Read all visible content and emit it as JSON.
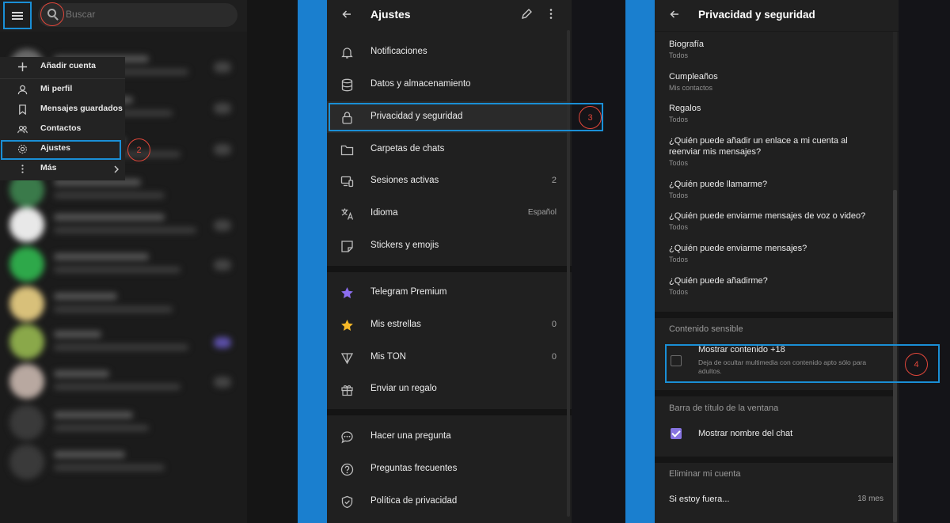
{
  "panel1": {
    "search": {
      "placeholder": "Buscar"
    },
    "menu": {
      "items": [
        {
          "label": "Añadir cuenta",
          "icon": "plus-icon"
        },
        {
          "label": "Mi perfil",
          "icon": "user-icon"
        },
        {
          "label": "Mensajes guardados",
          "icon": "bookmark-icon"
        },
        {
          "label": "Contactos",
          "icon": "contacts-icon"
        },
        {
          "label": "Ajustes",
          "icon": "gear-icon"
        },
        {
          "label": "Más",
          "icon": "more-vertical-icon"
        }
      ]
    },
    "step_badge": "2"
  },
  "panel2": {
    "title": "Ajustes",
    "items": [
      {
        "label": "Notificaciones",
        "icon": "bell-icon",
        "value": ""
      },
      {
        "label": "Datos y almacenamiento",
        "icon": "database-icon",
        "value": ""
      },
      {
        "label": "Privacidad y seguridad",
        "icon": "lock-icon",
        "value": ""
      },
      {
        "label": "Carpetas de chats",
        "icon": "folder-icon",
        "value": ""
      },
      {
        "label": "Sesiones activas",
        "icon": "devices-icon",
        "value": "2"
      },
      {
        "label": "Idioma",
        "icon": "translate-icon",
        "value": "Español"
      },
      {
        "label": "Stickers y emojis",
        "icon": "sticker-icon",
        "value": ""
      },
      {
        "label": "Telegram Premium",
        "icon": "premium-star-icon",
        "value": ""
      },
      {
        "label": "Mis estrellas",
        "icon": "star-icon",
        "value": "0"
      },
      {
        "label": "Mis TON",
        "icon": "ton-icon",
        "value": "0"
      },
      {
        "label": "Enviar un regalo",
        "icon": "gift-icon",
        "value": ""
      },
      {
        "label": "Hacer una pregunta",
        "icon": "chat-bubble-icon",
        "value": ""
      },
      {
        "label": "Preguntas frecuentes",
        "icon": "question-icon",
        "value": ""
      },
      {
        "label": "Política de privacidad",
        "icon": "shield-icon",
        "value": ""
      }
    ],
    "step_badge": "3"
  },
  "panel3": {
    "title": "Privacidad y seguridad",
    "privacy_items": [
      {
        "title": "Biografía",
        "value": "Todos"
      },
      {
        "title": "Cumpleaños",
        "value": "Mis contactos"
      },
      {
        "title": "Regalos",
        "value": "Todos"
      },
      {
        "title": "¿Quién puede añadir un enlace a mi cuenta al reenviar mis mensajes?",
        "value": "Todos"
      },
      {
        "title": "¿Quién puede llamarme?",
        "value": "Todos"
      },
      {
        "title": "¿Quién puede enviarme mensajes de voz o video?",
        "value": "Todos"
      },
      {
        "title": "¿Quién puede enviarme mensajes?",
        "value": "Todos"
      },
      {
        "title": "¿Quién puede añadirme?",
        "value": "Todos"
      }
    ],
    "sensitive": {
      "section": "Contenido sensible",
      "option_title": "Mostrar contenido +18",
      "option_desc": "Deja de ocultar multimedia con contenido apto sólo para adultos.",
      "checked": false
    },
    "window_title": {
      "section": "Barra de título de la ventana",
      "option_title": "Mostrar nombre del chat",
      "checked": true
    },
    "delete_account": {
      "section": "Eliminar mi cuenta",
      "label": "Si estoy fuera...",
      "value": "18 mes"
    },
    "step_badge": "4"
  },
  "colors": {
    "highlight": "#1a8fd6",
    "step_badge": "#e0463a",
    "accent_purple": "#8774e1",
    "star_yellow": "#f5b828"
  }
}
